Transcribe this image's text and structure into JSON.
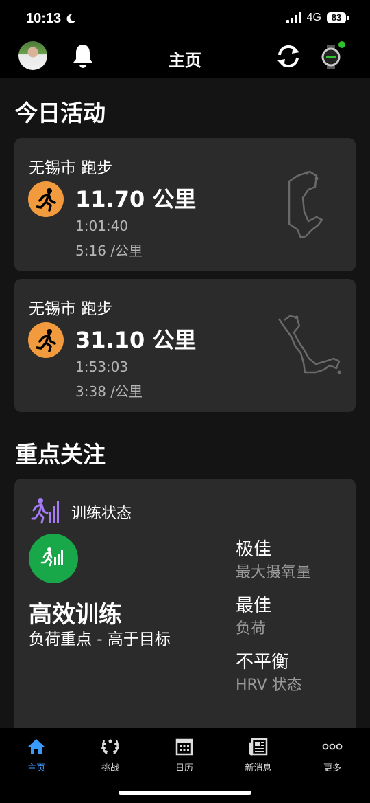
{
  "status_bar": {
    "time": "10:13",
    "network": "4G",
    "battery": "83"
  },
  "header": {
    "title": "主页"
  },
  "today": {
    "title": "今日活动",
    "activities": [
      {
        "title": "无锡市 跑步",
        "distance": "11.70 公里",
        "duration": "1:01:40",
        "pace": "5:16 /公里"
      },
      {
        "title": "无锡市 跑步",
        "distance": "31.10 公里",
        "duration": "1:53:03",
        "pace": "3:38 /公里"
      }
    ]
  },
  "focus": {
    "title": "重点关注",
    "training_status": {
      "label": "训练状态",
      "status": "高效训练",
      "subtitle": "负荷重点 - 高于目标",
      "metrics": [
        {
          "value": "极佳",
          "label": "最大摄氧量"
        },
        {
          "value": "最佳",
          "label": "负荷"
        },
        {
          "value": "不平衡",
          "label": "HRV 状态"
        }
      ]
    }
  },
  "tabs": [
    {
      "label": "主页",
      "icon": "home-icon",
      "active": true
    },
    {
      "label": "挑战",
      "icon": "laurel-icon",
      "active": false
    },
    {
      "label": "日历",
      "icon": "calendar-icon",
      "active": false
    },
    {
      "label": "新消息",
      "icon": "newsfeed-icon",
      "active": false
    },
    {
      "label": "更多",
      "icon": "more-icon",
      "active": false
    }
  ],
  "colors": {
    "accent": "#3a9bff",
    "run_orange": "#f19a3e",
    "status_green": "#18a84a",
    "card": "#2b2b2b",
    "connected_dot": "#2fc12f"
  }
}
